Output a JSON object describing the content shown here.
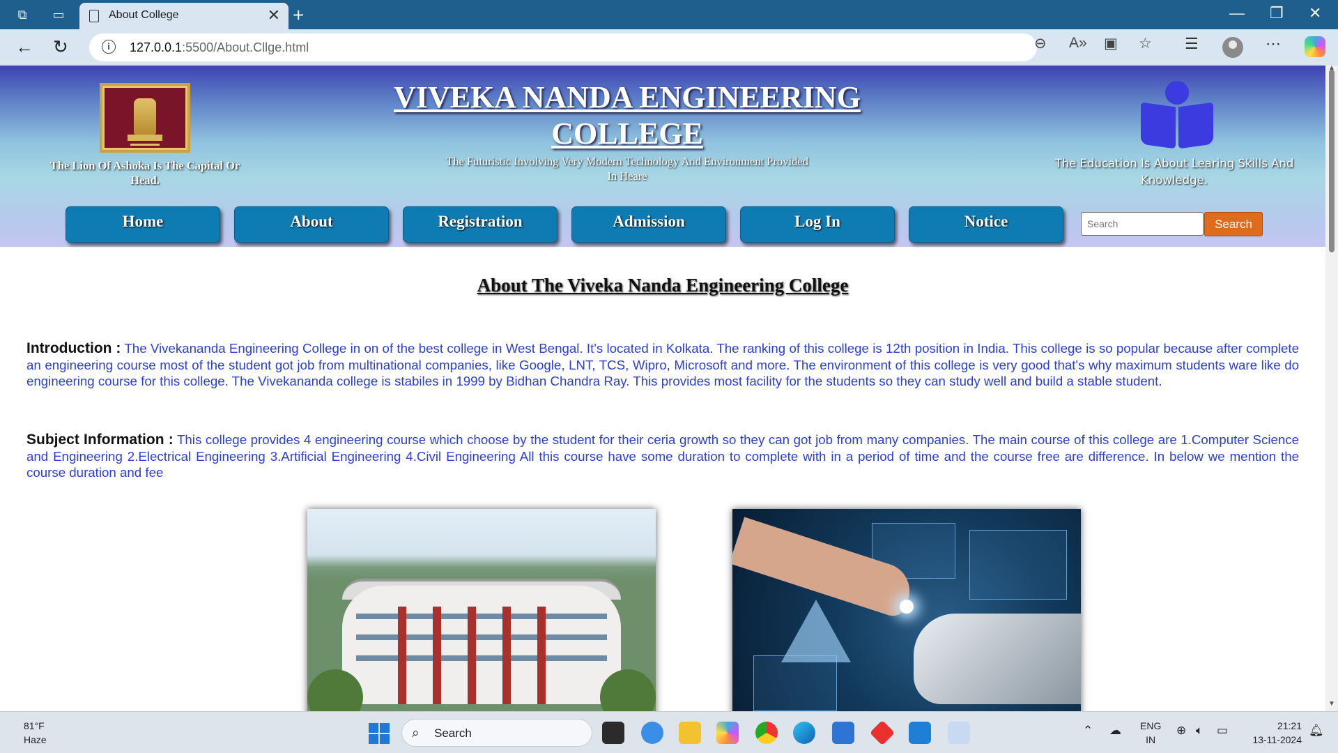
{
  "browser": {
    "tab_title": "About College",
    "tab_close": "✕",
    "new_tab": "+",
    "url_host": "127.0.0.1",
    "url_path": ":5500/About.Cllge.html",
    "win_minimize": "—",
    "win_restore": "❐",
    "win_close": "✕"
  },
  "header": {
    "emblem_caption": "The Lion Of Ashoka Is The Capital Or Head.",
    "college_name": "VIVEKA NANDA ENGINEERING COLLEGE",
    "tagline": "The Futuristic Involving Very Modern Technology And Environment Provided In Heare",
    "book_caption": "The Education Is About Learing Skills And Knowledge."
  },
  "nav": {
    "home": "Home",
    "about": "About",
    "registration": "Registration",
    "admission": "Admission",
    "login": "Log In",
    "notice": "Notice",
    "search_placeholder": "Search",
    "search_button": "Search"
  },
  "content": {
    "heading": "About The Viveka Nanda Engineering College",
    "intro_label": "Introduction :",
    "intro_text": "The Vivekananda Engineering College in on of the best college in West Bengal. It's located in Kolkata. The ranking of this college is 12th position in India. This college is so popular because after complete an engineering course most of the student got job from multinational companies, like Google, LNT, TCS, Wipro, Microsoft and more. The environment of this college is very good that's why maximum students ware like do engineering course for this college. The Vivekananda college is stabiles in 1999 by Bidhan Chandra Ray. This provides most facility for the students so they can study well and build a stable student.",
    "subject_label": "Subject Information :",
    "subject_text": "This college provides 4 engineering course which choose by the student for their ceria growth so they can got job from many companies. The main course of this college are 1.Computer Science and Engineering 2.Electrical Engineering 3.Artificial Engineering 4.Civil Engineering All this course have some duration to complete with in a period of time and the course free are difference. In below we mention the course duration and fee"
  },
  "taskbar": {
    "temperature": "81°F",
    "condition": "Haze",
    "search_label": "Search",
    "lang_top": "ENG",
    "lang_bottom": "IN",
    "time": "21:21",
    "date": "13-11-2024"
  },
  "colors": {
    "nav_button": "#0f7bb3",
    "search_button": "#df6b1c",
    "body_text": "#2b3fd3",
    "titlebar": "#1f5f8d"
  }
}
